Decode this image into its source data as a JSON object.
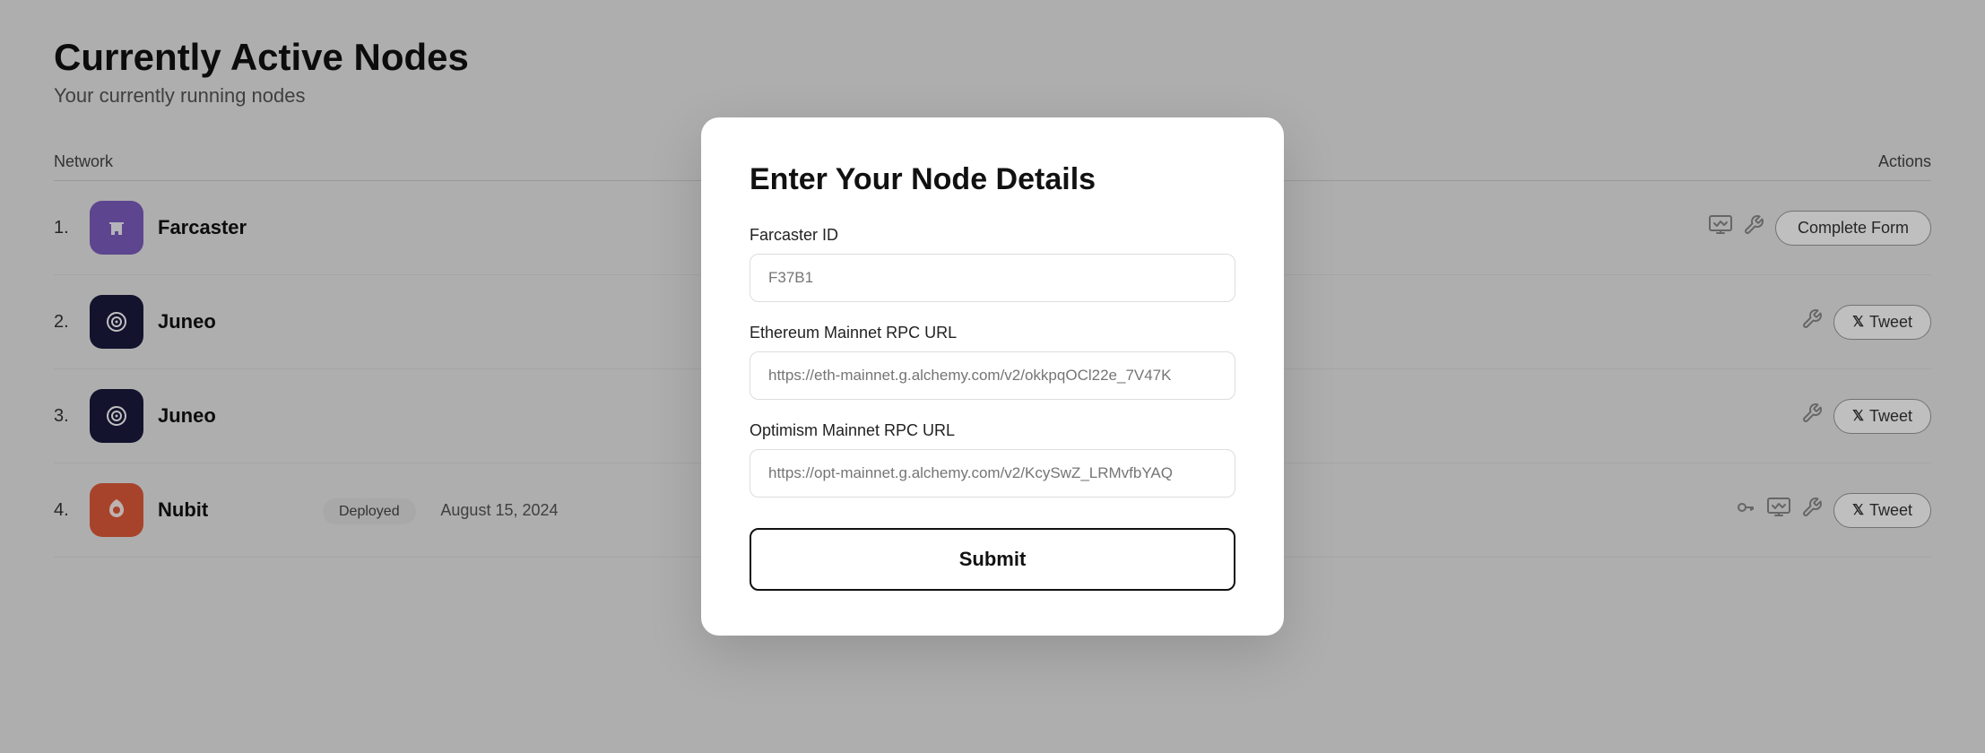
{
  "page": {
    "title": "Currently Active Nodes",
    "subtitle": "Your currently running nodes"
  },
  "table": {
    "headers": {
      "network": "Network",
      "actions": "Actions"
    },
    "rows": [
      {
        "num": "1.",
        "name": "Farcaster",
        "iconType": "farcaster",
        "iconSymbol": "⬡",
        "status": null,
        "date": null,
        "actions": [
          "monitor",
          "wrench",
          "complete-form"
        ]
      },
      {
        "num": "2.",
        "name": "Juneo",
        "iconType": "juneo",
        "iconSymbol": "◎",
        "status": null,
        "date": null,
        "actions": [
          "wrench",
          "tweet"
        ]
      },
      {
        "num": "3.",
        "name": "Juneo",
        "iconType": "juneo",
        "iconSymbol": "◎",
        "status": null,
        "date": null,
        "actions": [
          "wrench",
          "tweet"
        ]
      },
      {
        "num": "4.",
        "name": "Nubit",
        "iconType": "nubit",
        "iconSymbol": "✿",
        "status": "Deployed",
        "date": "August 15, 2024",
        "actions": [
          "key",
          "monitor",
          "wrench",
          "tweet"
        ]
      }
    ]
  },
  "modal": {
    "title": "Enter Your Node Details",
    "fields": [
      {
        "label": "Farcaster ID",
        "placeholder": "F37B1",
        "name": "farcaster-id"
      },
      {
        "label": "Ethereum Mainnet RPC URL",
        "placeholder": "https://eth-mainnet.g.alchemy.com/v2/okkpqOCl22e_7V47K",
        "name": "eth-rpc-url"
      },
      {
        "label": "Optimism Mainnet RPC URL",
        "placeholder": "https://opt-mainnet.g.alchemy.com/v2/KcySwZ_LRMvfbYAQ",
        "name": "opt-rpc-url"
      }
    ],
    "submit_label": "Submit"
  },
  "buttons": {
    "complete_form": "Complete Form",
    "tweet": "Tweet"
  }
}
